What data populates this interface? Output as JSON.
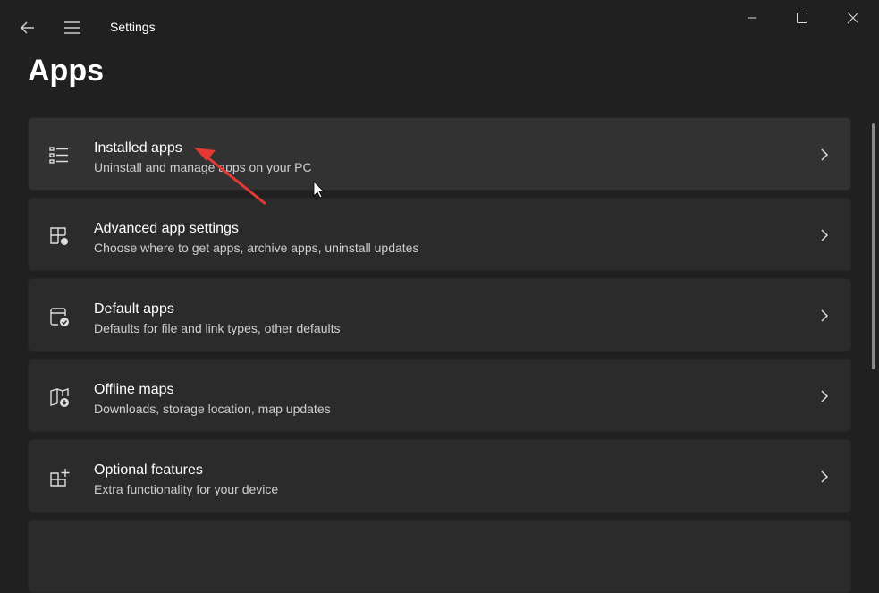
{
  "window": {
    "title": "Settings"
  },
  "page_title": "Apps",
  "items": [
    {
      "title": "Installed apps",
      "subtitle": "Uninstall and manage apps on your PC"
    },
    {
      "title": "Advanced app settings",
      "subtitle": "Choose where to get apps, archive apps, uninstall updates"
    },
    {
      "title": "Default apps",
      "subtitle": "Defaults for file and link types, other defaults"
    },
    {
      "title": "Offline maps",
      "subtitle": "Downloads, storage location, map updates"
    },
    {
      "title": "Optional features",
      "subtitle": "Extra functionality for your device"
    }
  ],
  "colors": {
    "annotation_arrow": "#e53935"
  }
}
